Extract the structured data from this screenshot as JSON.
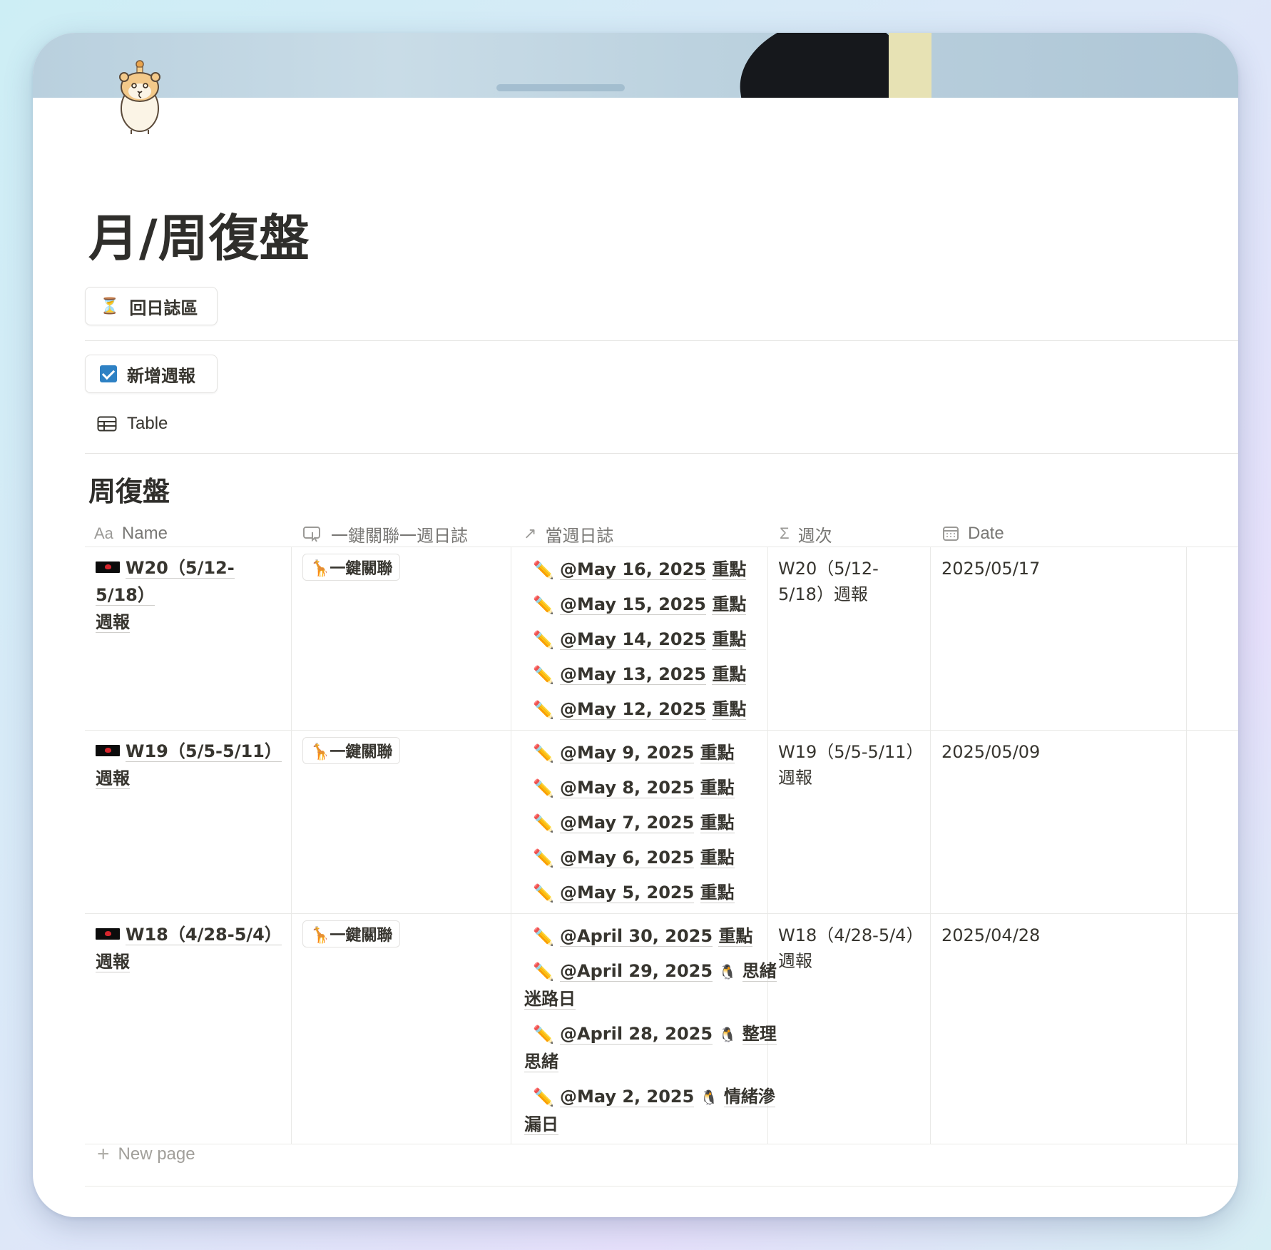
{
  "page": {
    "title": "月/周復盤",
    "back_button_label": "回日誌區",
    "new_report_button_label": "新增週報",
    "view_tab_label": "Table"
  },
  "database": {
    "title": "周復盤",
    "columns": [
      {
        "icon": "Aa",
        "label": "Name"
      },
      {
        "icon": "button-icon",
        "label": "一鍵關聯一週日誌"
      },
      {
        "icon": "↗",
        "label": "當週日誌"
      },
      {
        "icon": "Σ",
        "label": "週次"
      },
      {
        "icon": "calendar-icon",
        "label": "Date"
      }
    ],
    "rows": [
      {
        "name_line1": "W20（5/12-5/18）",
        "name_line2": "週報",
        "link_button": "🦒一鍵關聯",
        "journals": [
          {
            "date": "@May 16, 2025",
            "title": "重點"
          },
          {
            "date": "@May 15, 2025",
            "title": "重點"
          },
          {
            "date": "@May 14, 2025",
            "title": "重點"
          },
          {
            "date": "@May 13, 2025",
            "title": "重點"
          },
          {
            "date": "@May 12, 2025",
            "title": "重點"
          }
        ],
        "week_line1": "W20（5/12-",
        "week_line2": "5/18）週報",
        "date": "2025/05/17"
      },
      {
        "name_line1": "W19（5/5-5/11）",
        "name_line2": "週報",
        "link_button": "🦒一鍵關聯",
        "journals": [
          {
            "date": "@May 9, 2025",
            "title": "重點"
          },
          {
            "date": "@May 8, 2025",
            "title": "重點"
          },
          {
            "date": "@May 7, 2025",
            "title": "重點"
          },
          {
            "date": "@May 6, 2025",
            "title": "重點"
          },
          {
            "date": "@May 5, 2025",
            "title": "重點"
          }
        ],
        "week_line1": "W19（5/5-5/11）",
        "week_line2": "週報",
        "date": "2025/05/09"
      },
      {
        "name_line1": "W18（4/28-5/4）",
        "name_line2": "週報",
        "link_button": "🦒一鍵關聯",
        "journals": [
          {
            "date": "@April 30, 2025",
            "title": "重點",
            "title_line2": ""
          },
          {
            "date": "@April 29, 2025",
            "title": "思緒",
            "title_line2": "迷路日",
            "emoji": "🐧"
          },
          {
            "date": "@April 28, 2025",
            "title": "整理",
            "title_line2": "思緒",
            "emoji": "🐧"
          },
          {
            "date": "@May 2, 2025",
            "title": "情緒滲",
            "title_line2": "漏日",
            "emoji": "🐧"
          }
        ],
        "week_line1": "W18（4/28-5/4）",
        "week_line2": "週報",
        "date": "2025/04/28"
      }
    ],
    "new_page_label": "New page"
  }
}
